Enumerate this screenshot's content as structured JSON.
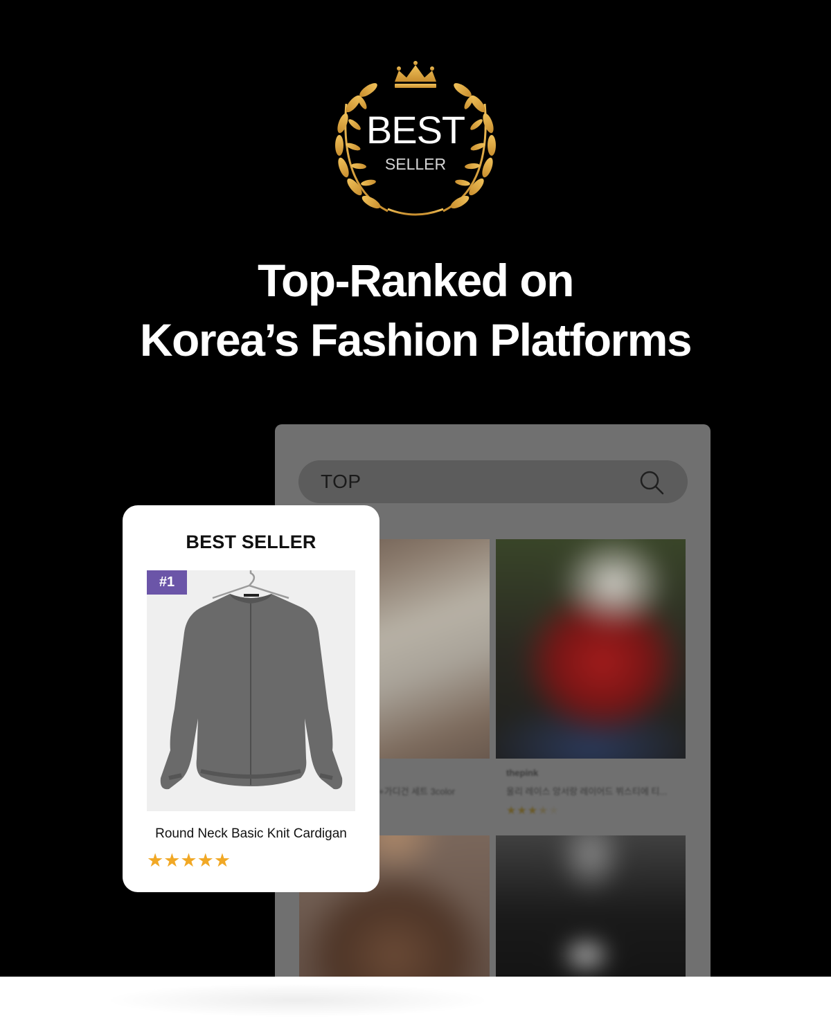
{
  "badge": {
    "line1": "BEST",
    "line2": "SELLER"
  },
  "headline": {
    "line1": "Top-Ranked on",
    "line2": "Korea’s Fashion Platforms"
  },
  "search": {
    "query": "TOP",
    "icon": "search-icon"
  },
  "listing": {
    "brand": "thepink",
    "item1_name": "+가디건 세트 3color",
    "item2_name": "울리 레이스 앙서랑 레이어드 뷔스티에 티...",
    "item2_rating": 3.5
  },
  "card": {
    "title": "BEST SELLER",
    "rank": "#1",
    "product_name": "Round Neck Basic Knit Cardigan",
    "rating": 5,
    "stars": "★★★★★"
  },
  "colors": {
    "background": "#000000",
    "gold": "#d9a445",
    "rank_badge": "#6b55a8",
    "star": "#f1a825"
  }
}
